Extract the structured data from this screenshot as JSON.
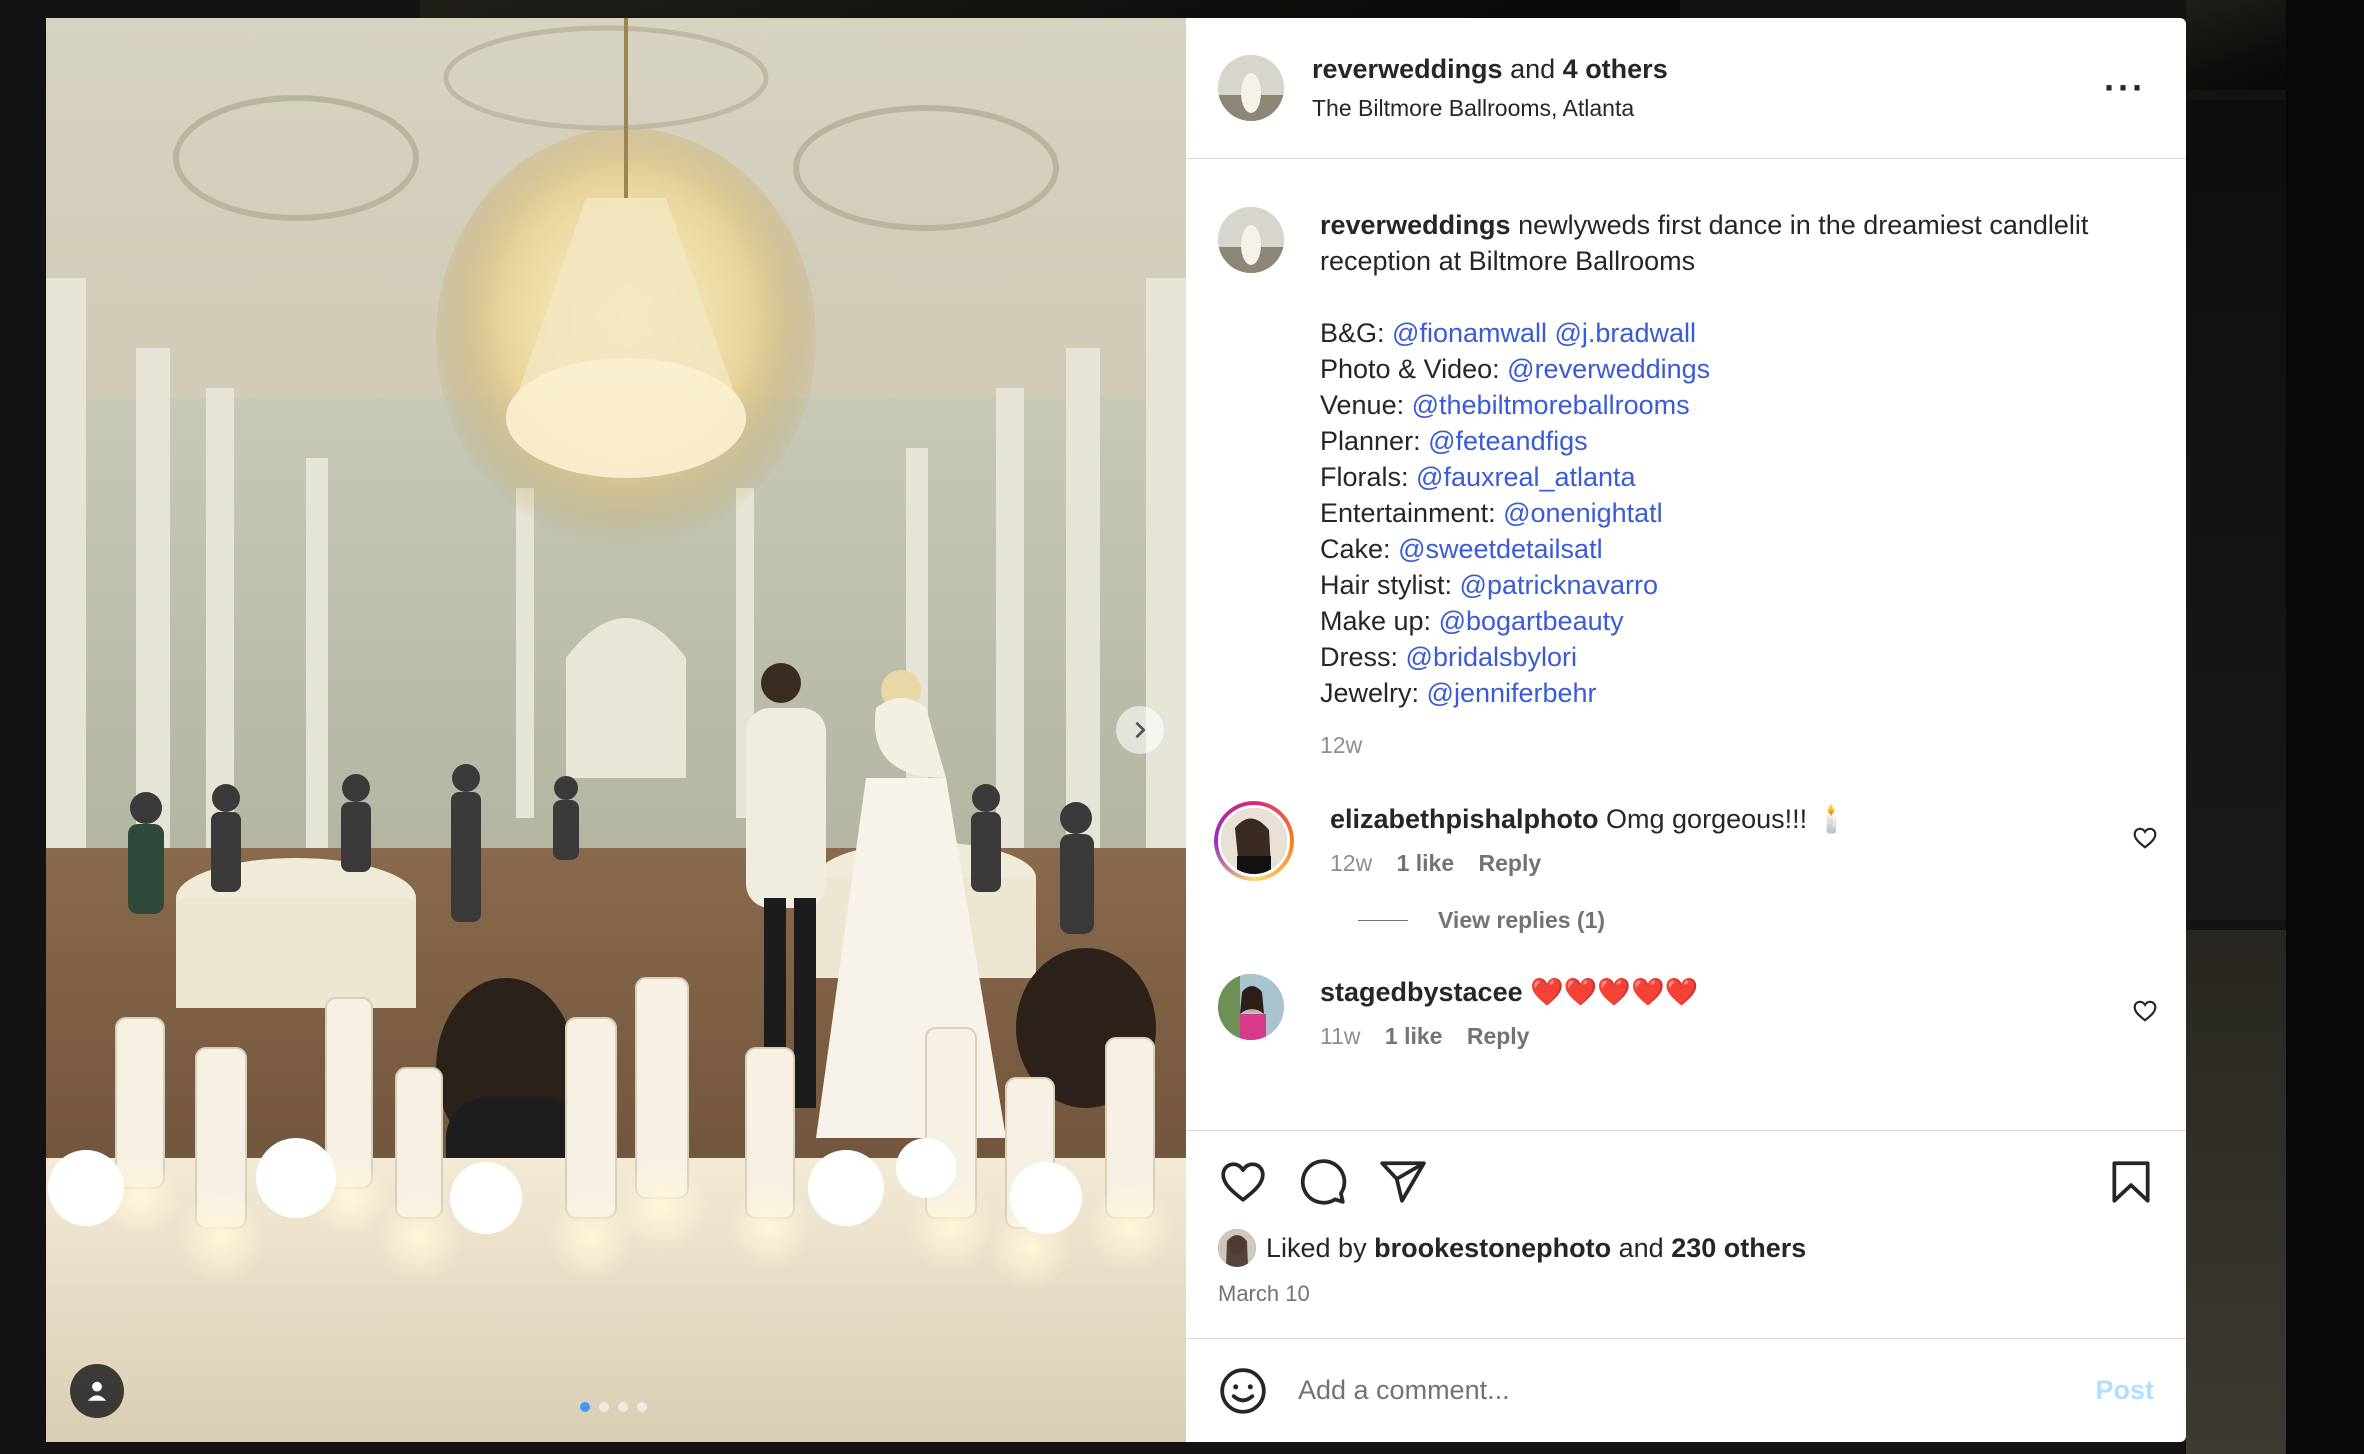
{
  "post": {
    "author": "reverweddings",
    "coauthors_text": "and",
    "coauthors_count": "4 others",
    "location": "The Biltmore Ballrooms, Atlanta",
    "more_icon": "more-horizontal-icon"
  },
  "caption": {
    "username": "reverweddings",
    "text": "newlyweds first dance in the dreamiest candlelit reception at Biltmore Ballrooms",
    "credits": [
      {
        "label": "B&G:",
        "handles": "@fionamwall @j.bradwall"
      },
      {
        "label": "Photo & Video:",
        "handles": "@reverweddings"
      },
      {
        "label": "Venue:",
        "handles": "@thebiltmoreballrooms"
      },
      {
        "label": "Planner:",
        "handles": "@feteandfigs"
      },
      {
        "label": "Florals:",
        "handles": "@fauxreal_atlanta"
      },
      {
        "label": "Entertainment:",
        "handles": "@onenightatl"
      },
      {
        "label": "Cake:",
        "handles": "@sweetdetailsatl"
      },
      {
        "label": "Hair stylist:",
        "handles": "@patricknavarro"
      },
      {
        "label": "Make up:",
        "handles": "@bogartbeauty"
      },
      {
        "label": "Dress:",
        "handles": "@bridalsbylori"
      },
      {
        "label": "Jewelry:",
        "handles": "@jenniferbehr"
      }
    ],
    "age": "12w"
  },
  "comments": [
    {
      "username": "elizabethpishalphoto",
      "text": "Omg gorgeous!!! 🕯️",
      "age": "12w",
      "likes": "1 like",
      "reply": "Reply"
    },
    {
      "username": "stagedbystacee",
      "text": "❤️❤️❤️❤️❤️",
      "age": "11w",
      "likes": "1 like",
      "reply": "Reply"
    }
  ],
  "view_replies": "View replies (1)",
  "liked": {
    "prefix": "Liked by",
    "user": "brookestonephoto",
    "and": "and",
    "others": "230 others"
  },
  "date": "March 10",
  "add_comment": {
    "placeholder": "Add a comment...",
    "post": "Post"
  },
  "colors": {
    "link": "#3b5bd6",
    "post_disabled": "#b2dffc",
    "active_dot": "#3b9cff"
  },
  "carousel": {
    "slides": 4,
    "active": 0
  }
}
